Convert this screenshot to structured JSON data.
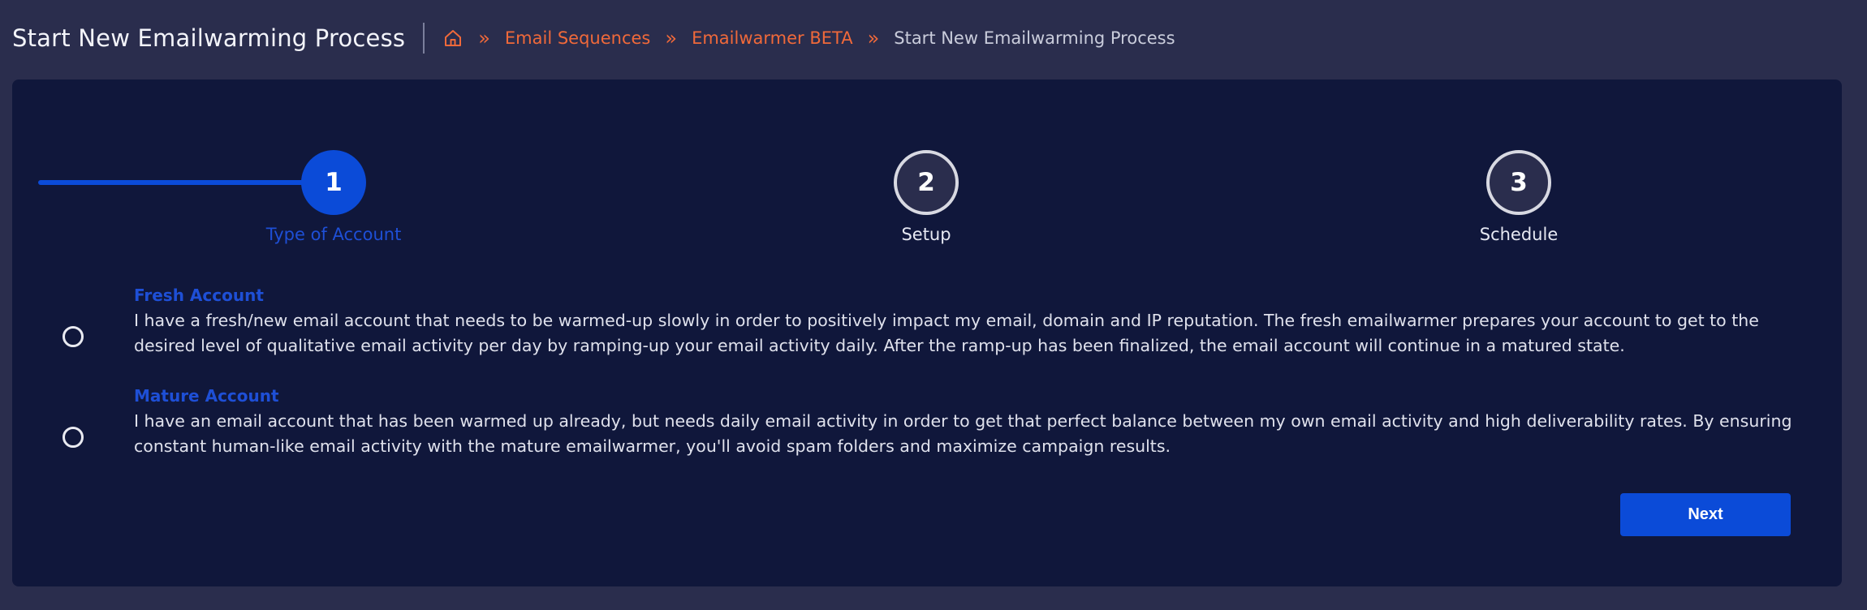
{
  "header": {
    "title": "Start New Emailwarming Process",
    "breadcrumb": {
      "home_icon": "home-icon",
      "separator": "»",
      "links": [
        "Email Sequences",
        "Emailwarmer BETA"
      ],
      "current": "Start New Emailwarming Process"
    }
  },
  "stepper": {
    "steps": [
      {
        "number": "1",
        "label": "Type of Account",
        "state": "active"
      },
      {
        "number": "2",
        "label": "Setup",
        "state": "inactive"
      },
      {
        "number": "3",
        "label": "Schedule",
        "state": "inactive"
      }
    ]
  },
  "options": [
    {
      "title": "Fresh Account",
      "description": "I have a fresh/new email account that needs to be warmed-up slowly in order to positively impact my email, domain and IP reputation. The fresh emailwarmer prepares your account to get to the desired level of qualitative email activity per day by ramping-up your email activity daily. After the ramp-up has been finalized, the email account will continue in a matured state.",
      "selected": false
    },
    {
      "title": "Mature Account",
      "description": "I have an email account that has been warmed up already, but needs daily email activity in order to get that perfect balance between my own email activity and high deliverability rates. By ensuring constant human-like email activity with the mature emailwarmer, you'll avoid spam folders and maximize campaign results.",
      "selected": false
    }
  ],
  "actions": {
    "next_label": "Next"
  },
  "colors": {
    "accent": "#0b4bd8",
    "link": "#f0693a",
    "card_bg": "#10173b",
    "page_bg": "#2a2d4d"
  }
}
